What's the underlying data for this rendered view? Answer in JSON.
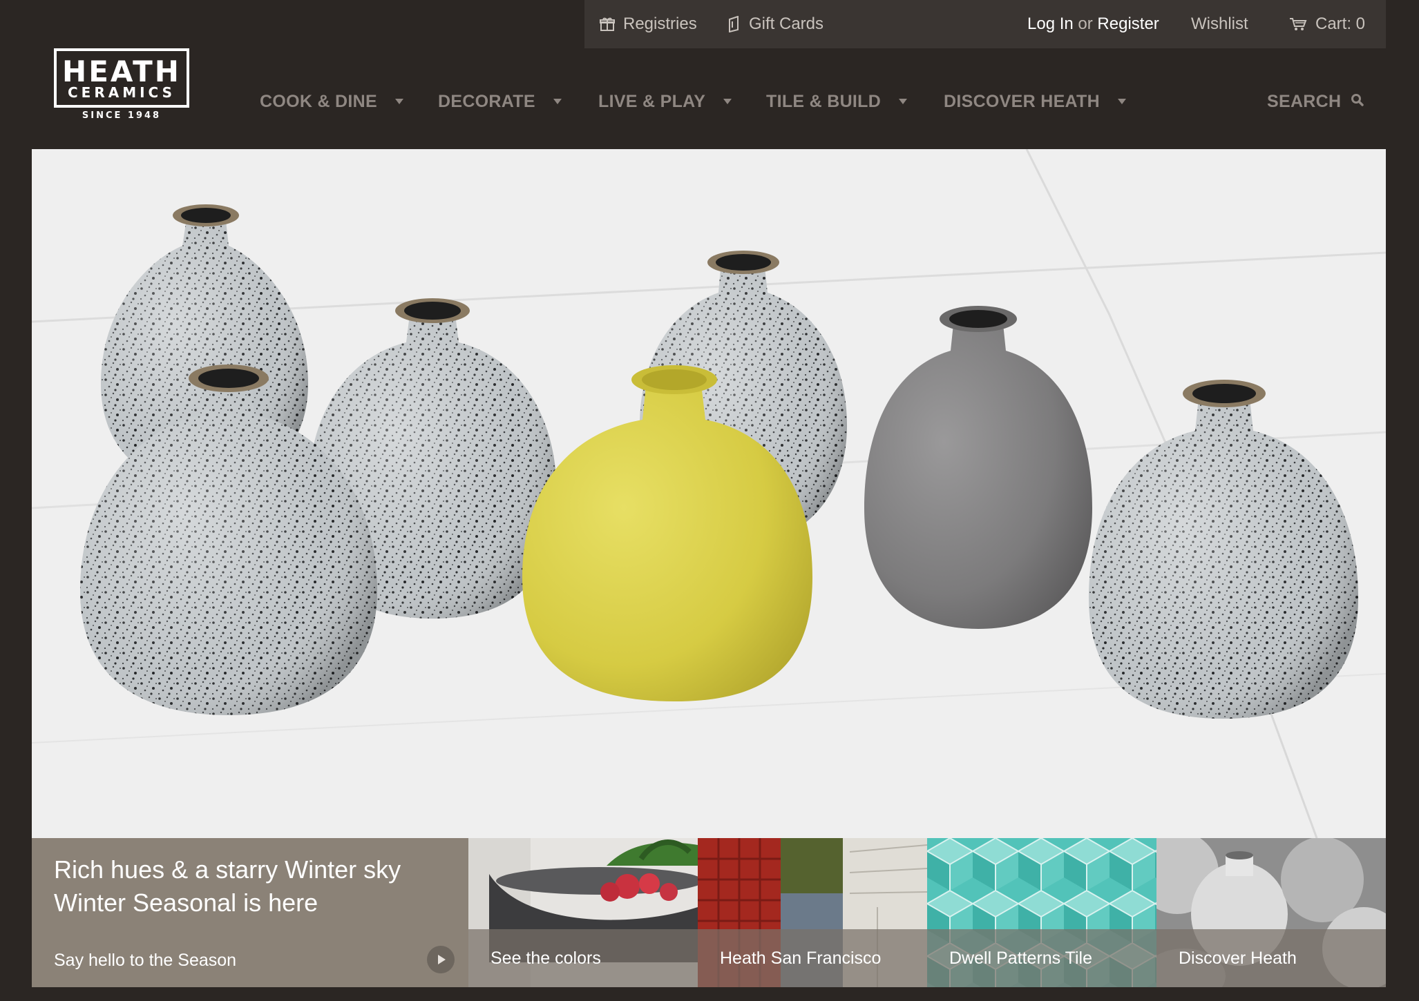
{
  "utility": {
    "registries": "Registries",
    "gift_cards": "Gift Cards",
    "log_in": "Log In",
    "or": "or",
    "register": "Register",
    "wishlist": "Wishlist",
    "cart": "Cart: 0"
  },
  "logo": {
    "line1": "HEATH",
    "line2": "CERAMICS",
    "since": "SINCE 1948"
  },
  "nav": {
    "items": [
      {
        "label": "COOK & DINE"
      },
      {
        "label": "DECORATE"
      },
      {
        "label": "LIVE & PLAY"
      },
      {
        "label": "TILE & BUILD"
      },
      {
        "label": "DISCOVER HEATH"
      }
    ],
    "search": "SEARCH"
  },
  "promo": {
    "headline_1": "Rich hues & a starry Winter sky",
    "headline_2": "Winter Seasonal is here",
    "link": "Say hello to the Season"
  },
  "tiles": [
    {
      "caption": "See the colors"
    },
    {
      "caption": "Heath San Francisco"
    },
    {
      "caption": "Dwell Patterns Tile"
    },
    {
      "caption": "Discover Heath"
    }
  ],
  "colors": {
    "background": "#2b2623",
    "utility_bar": "#3a3532",
    "nav_text": "#8f8782",
    "promo_panel": "#8b8277",
    "yellow_vase": "#d9cf4a",
    "gray_vase": "#7d7c7d",
    "speckled_vase": "#bfc4c7"
  },
  "icons": [
    "gift-icon",
    "gift-card-icon",
    "cart-icon",
    "search-icon",
    "play-icon",
    "caret-down-icon"
  ]
}
